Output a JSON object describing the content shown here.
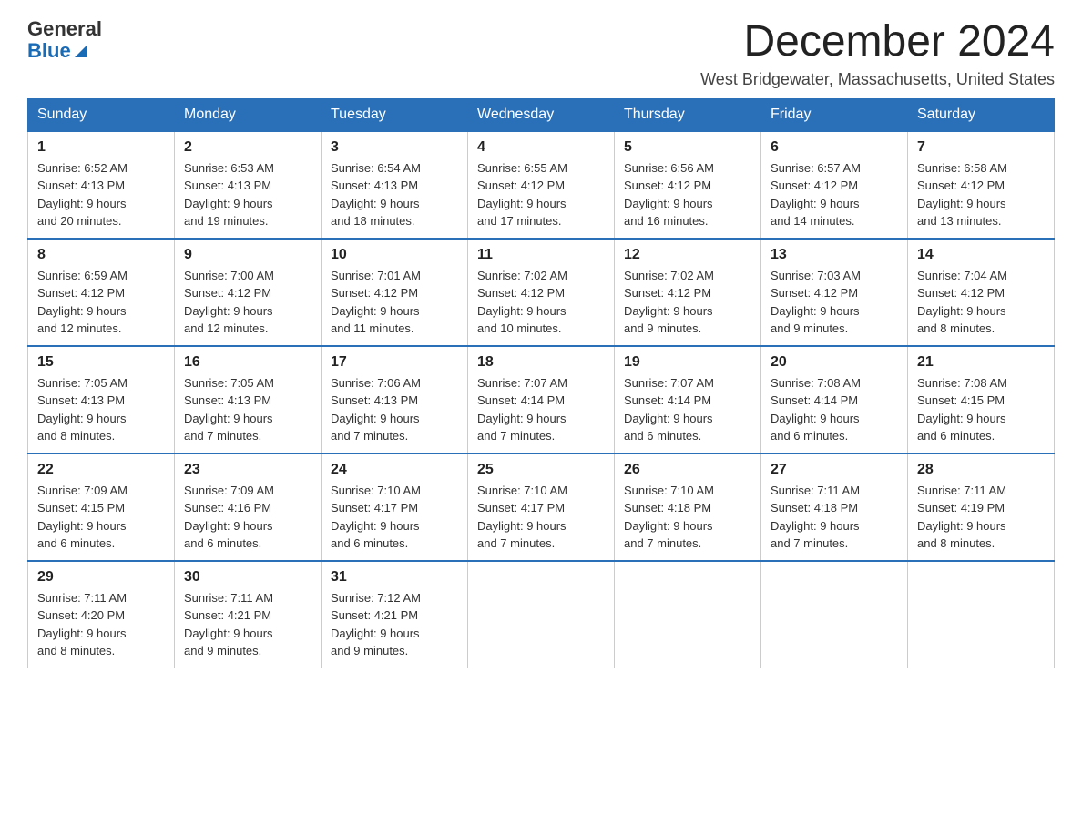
{
  "logo": {
    "general": "General",
    "blue": "Blue"
  },
  "title": "December 2024",
  "location": "West Bridgewater, Massachusetts, United States",
  "weekdays": [
    "Sunday",
    "Monday",
    "Tuesday",
    "Wednesday",
    "Thursday",
    "Friday",
    "Saturday"
  ],
  "weeks": [
    [
      {
        "day": "1",
        "sunrise": "6:52 AM",
        "sunset": "4:13 PM",
        "daylight": "9 hours and 20 minutes."
      },
      {
        "day": "2",
        "sunrise": "6:53 AM",
        "sunset": "4:13 PM",
        "daylight": "9 hours and 19 minutes."
      },
      {
        "day": "3",
        "sunrise": "6:54 AM",
        "sunset": "4:13 PM",
        "daylight": "9 hours and 18 minutes."
      },
      {
        "day": "4",
        "sunrise": "6:55 AM",
        "sunset": "4:12 PM",
        "daylight": "9 hours and 17 minutes."
      },
      {
        "day": "5",
        "sunrise": "6:56 AM",
        "sunset": "4:12 PM",
        "daylight": "9 hours and 16 minutes."
      },
      {
        "day": "6",
        "sunrise": "6:57 AM",
        "sunset": "4:12 PM",
        "daylight": "9 hours and 14 minutes."
      },
      {
        "day": "7",
        "sunrise": "6:58 AM",
        "sunset": "4:12 PM",
        "daylight": "9 hours and 13 minutes."
      }
    ],
    [
      {
        "day": "8",
        "sunrise": "6:59 AM",
        "sunset": "4:12 PM",
        "daylight": "9 hours and 12 minutes."
      },
      {
        "day": "9",
        "sunrise": "7:00 AM",
        "sunset": "4:12 PM",
        "daylight": "9 hours and 12 minutes."
      },
      {
        "day": "10",
        "sunrise": "7:01 AM",
        "sunset": "4:12 PM",
        "daylight": "9 hours and 11 minutes."
      },
      {
        "day": "11",
        "sunrise": "7:02 AM",
        "sunset": "4:12 PM",
        "daylight": "9 hours and 10 minutes."
      },
      {
        "day": "12",
        "sunrise": "7:02 AM",
        "sunset": "4:12 PM",
        "daylight": "9 hours and 9 minutes."
      },
      {
        "day": "13",
        "sunrise": "7:03 AM",
        "sunset": "4:12 PM",
        "daylight": "9 hours and 9 minutes."
      },
      {
        "day": "14",
        "sunrise": "7:04 AM",
        "sunset": "4:12 PM",
        "daylight": "9 hours and 8 minutes."
      }
    ],
    [
      {
        "day": "15",
        "sunrise": "7:05 AM",
        "sunset": "4:13 PM",
        "daylight": "9 hours and 8 minutes."
      },
      {
        "day": "16",
        "sunrise": "7:05 AM",
        "sunset": "4:13 PM",
        "daylight": "9 hours and 7 minutes."
      },
      {
        "day": "17",
        "sunrise": "7:06 AM",
        "sunset": "4:13 PM",
        "daylight": "9 hours and 7 minutes."
      },
      {
        "day": "18",
        "sunrise": "7:07 AM",
        "sunset": "4:14 PM",
        "daylight": "9 hours and 7 minutes."
      },
      {
        "day": "19",
        "sunrise": "7:07 AM",
        "sunset": "4:14 PM",
        "daylight": "9 hours and 6 minutes."
      },
      {
        "day": "20",
        "sunrise": "7:08 AM",
        "sunset": "4:14 PM",
        "daylight": "9 hours and 6 minutes."
      },
      {
        "day": "21",
        "sunrise": "7:08 AM",
        "sunset": "4:15 PM",
        "daylight": "9 hours and 6 minutes."
      }
    ],
    [
      {
        "day": "22",
        "sunrise": "7:09 AM",
        "sunset": "4:15 PM",
        "daylight": "9 hours and 6 minutes."
      },
      {
        "day": "23",
        "sunrise": "7:09 AM",
        "sunset": "4:16 PM",
        "daylight": "9 hours and 6 minutes."
      },
      {
        "day": "24",
        "sunrise": "7:10 AM",
        "sunset": "4:17 PM",
        "daylight": "9 hours and 6 minutes."
      },
      {
        "day": "25",
        "sunrise": "7:10 AM",
        "sunset": "4:17 PM",
        "daylight": "9 hours and 7 minutes."
      },
      {
        "day": "26",
        "sunrise": "7:10 AM",
        "sunset": "4:18 PM",
        "daylight": "9 hours and 7 minutes."
      },
      {
        "day": "27",
        "sunrise": "7:11 AM",
        "sunset": "4:18 PM",
        "daylight": "9 hours and 7 minutes."
      },
      {
        "day": "28",
        "sunrise": "7:11 AM",
        "sunset": "4:19 PM",
        "daylight": "9 hours and 8 minutes."
      }
    ],
    [
      {
        "day": "29",
        "sunrise": "7:11 AM",
        "sunset": "4:20 PM",
        "daylight": "9 hours and 8 minutes."
      },
      {
        "day": "30",
        "sunrise": "7:11 AM",
        "sunset": "4:21 PM",
        "daylight": "9 hours and 9 minutes."
      },
      {
        "day": "31",
        "sunrise": "7:12 AM",
        "sunset": "4:21 PM",
        "daylight": "9 hours and 9 minutes."
      },
      null,
      null,
      null,
      null
    ]
  ],
  "labels": {
    "sunrise": "Sunrise:",
    "sunset": "Sunset:",
    "daylight": "Daylight:"
  }
}
